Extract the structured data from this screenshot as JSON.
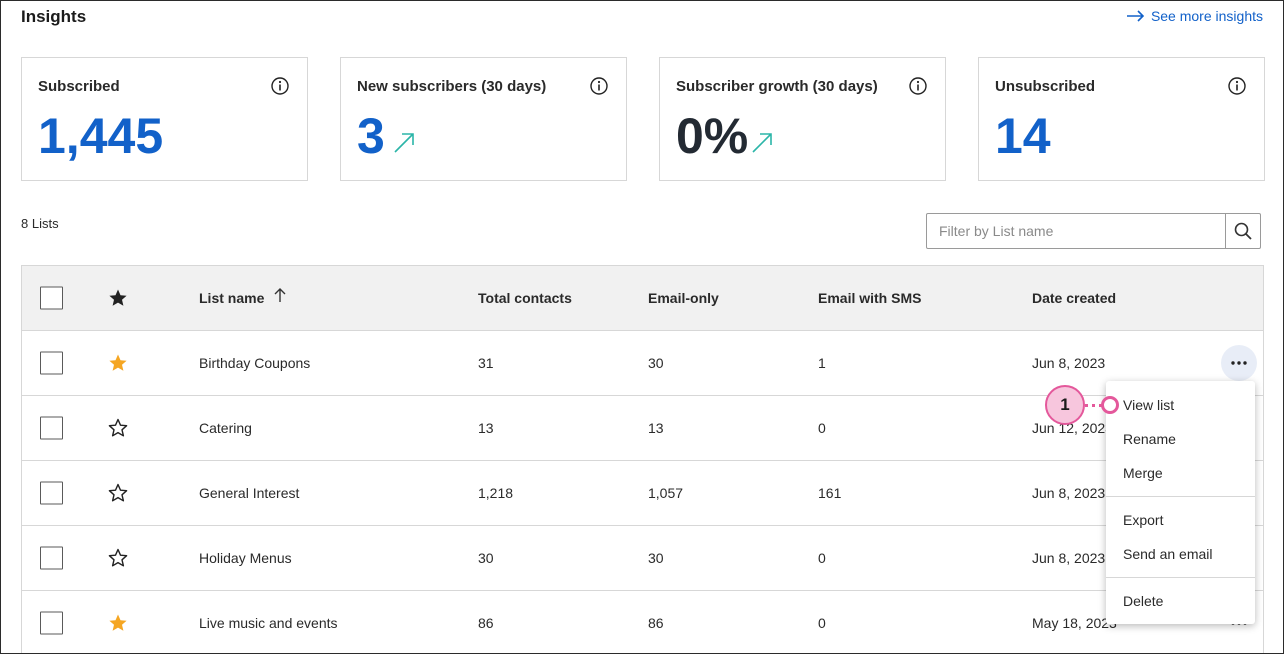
{
  "header": {
    "title": "Insights",
    "see_more": "See more insights"
  },
  "cards": [
    {
      "label": "Subscribed",
      "value": "1,445",
      "value_color": "#1261c9",
      "trend": ""
    },
    {
      "label": "New subscribers (30 days)",
      "value": "3",
      "value_color": "#1261c9",
      "trend": "trend-up-icon"
    },
    {
      "label": "Subscriber growth (30 days)",
      "value": "0%",
      "value_color": "#232a33",
      "trend": "trend-up-icon"
    },
    {
      "label": "Unsubscribed",
      "value": "14",
      "value_color": "#1261c9",
      "trend": ""
    }
  ],
  "lists": {
    "count_label": "8 Lists",
    "filter_placeholder": "Filter by List name"
  },
  "table": {
    "columns": [
      "List name",
      "Total contacts",
      "Email-only",
      "Email with SMS",
      "Date created"
    ],
    "rows": [
      {
        "starred": true,
        "name": "Birthday Coupons",
        "total": "31",
        "email_only": "30",
        "sms": "1",
        "date": "Jun 8, 2023"
      },
      {
        "starred": false,
        "name": "Catering",
        "total": "13",
        "email_only": "13",
        "sms": "0",
        "date": "Jun 12, 2023"
      },
      {
        "starred": false,
        "name": "General Interest",
        "total": "1,218",
        "email_only": "1,057",
        "sms": "161",
        "date": "Jun 8, 2023"
      },
      {
        "starred": false,
        "name": "Holiday Menus",
        "total": "30",
        "email_only": "30",
        "sms": "0",
        "date": "Jun 8, 2023"
      },
      {
        "starred": true,
        "name": "Live music and events",
        "total": "86",
        "email_only": "86",
        "sms": "0",
        "date": "May 18, 2023"
      }
    ]
  },
  "menu": {
    "items": [
      "View list",
      "Rename",
      "Merge",
      "Export",
      "Send an email",
      "Delete"
    ]
  },
  "callout": {
    "number": "1"
  },
  "colors": {
    "accent": "#1261c9",
    "star": "#f5a623",
    "callout": "#e4589b",
    "trend": "#2bb5a8"
  }
}
